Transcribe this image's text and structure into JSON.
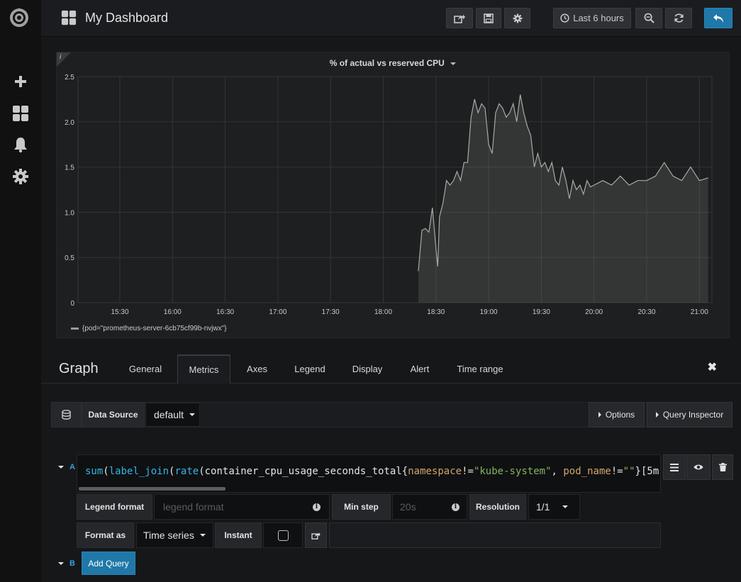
{
  "sidebar": {
    "icons": [
      "grafana-logo-icon",
      "plus-icon",
      "dashboards-icon",
      "alert-bell-icon",
      "gear-icon"
    ]
  },
  "topbar": {
    "title": "My Dashboard",
    "time_range_label": "Last 6 hours"
  },
  "panel": {
    "title": "% of actual vs reserved CPU",
    "info_label": "i",
    "legend_label": "{pod=\"prometheus-server-6cb75cf99b-nvjwx\"}"
  },
  "chart_data": {
    "type": "area",
    "title": "% of actual vs reserved CPU",
    "ylim": [
      0,
      2.5
    ],
    "y_ticks": [
      "0",
      "0.5",
      "1.0",
      "1.5",
      "2.0",
      "2.5"
    ],
    "x_ticks": [
      "15:30",
      "16:00",
      "16:30",
      "17:00",
      "17:30",
      "18:00",
      "18:30",
      "19:00",
      "19:30",
      "20:00",
      "20:30",
      "21:00"
    ],
    "grid": true,
    "series": [
      {
        "name": "{pod=\"prometheus-server-6cb75cf99b-nvjwx\"}",
        "x": [
          "18:20",
          "18:22",
          "18:24",
          "18:26",
          "18:28",
          "18:30",
          "18:31",
          "18:32",
          "18:34",
          "18:36",
          "18:38",
          "18:40",
          "18:42",
          "18:44",
          "18:46",
          "18:48",
          "18:50",
          "18:52",
          "18:54",
          "18:56",
          "18:58",
          "19:00",
          "19:02",
          "19:04",
          "19:06",
          "19:08",
          "19:10",
          "19:12",
          "19:14",
          "19:16",
          "19:18",
          "19:20",
          "19:22",
          "19:24",
          "19:26",
          "19:28",
          "19:30",
          "19:32",
          "19:34",
          "19:36",
          "19:38",
          "19:40",
          "19:42",
          "19:44",
          "19:46",
          "19:48",
          "19:50",
          "19:52",
          "19:54",
          "19:56",
          "19:58",
          "20:00",
          "20:05",
          "20:10",
          "20:15",
          "20:20",
          "20:25",
          "20:30",
          "20:35",
          "20:40",
          "20:45",
          "20:50",
          "20:55",
          "21:00",
          "21:05"
        ],
        "values": [
          0.35,
          0.8,
          0.82,
          0.78,
          1.05,
          0.6,
          0.4,
          0.95,
          1.1,
          1.35,
          1.3,
          1.35,
          1.45,
          1.35,
          1.55,
          1.55,
          2.05,
          2.25,
          2.1,
          2.2,
          2.15,
          1.75,
          1.65,
          2.1,
          2.2,
          2.15,
          2.05,
          2.1,
          2.2,
          2.0,
          2.3,
          2.1,
          1.95,
          1.85,
          1.5,
          1.65,
          1.5,
          1.55,
          1.45,
          1.55,
          1.35,
          1.3,
          1.5,
          1.35,
          1.15,
          1.35,
          1.25,
          1.3,
          1.2,
          1.35,
          1.28,
          1.3,
          1.35,
          1.3,
          1.4,
          1.3,
          1.35,
          1.35,
          1.4,
          1.55,
          1.4,
          1.35,
          1.5,
          1.35,
          1.38
        ]
      }
    ]
  },
  "editor": {
    "title": "Graph",
    "tabs": [
      "General",
      "Metrics",
      "Axes",
      "Legend",
      "Display",
      "Alert",
      "Time range"
    ],
    "active_tab": "Metrics",
    "datasource_label": "Data Source",
    "datasource_value": "default",
    "options_label": "Options",
    "query_inspector_label": "Query Inspector",
    "query_a": {
      "letter": "A",
      "expr_parts": [
        "sum",
        "(",
        "label_join",
        "(",
        "rate",
        "(",
        "container_cpu_usage_seconds_total",
        "{",
        "namespace",
        "!=",
        "\"kube-system\"",
        ", ",
        "pod_name",
        "!=",
        "\"\"",
        "}[5m]"
      ],
      "legend_format_label": "Legend format",
      "legend_format_placeholder": "legend format",
      "min_step_label": "Min step",
      "min_step_placeholder": "20s",
      "resolution_label": "Resolution",
      "resolution_value": "1/1",
      "format_as_label": "Format as",
      "format_as_value": "Time series",
      "instant_label": "Instant"
    },
    "query_b": {
      "letter": "B",
      "add_query_label": "Add Query"
    }
  }
}
